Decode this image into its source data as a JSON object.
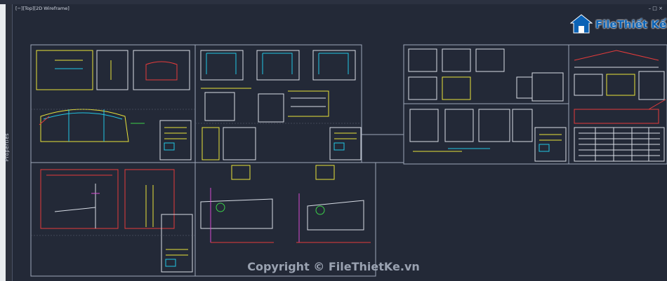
{
  "viewport": {
    "label": "[−][Top][2D Wireframe]",
    "window_controls": "– □ ×"
  },
  "properties_label": "Properties",
  "watermark": {
    "logo_text": "FileThiết Kế.vn",
    "copyright": "Copyright © FileThietKe.vn"
  },
  "colors": {
    "background": "#232937",
    "frame": "#9ea6b8",
    "yellow": "#e8e23a",
    "cyan": "#22c7e6",
    "red": "#e63b3b",
    "magenta": "#d64bd0",
    "green": "#3cd24a"
  }
}
